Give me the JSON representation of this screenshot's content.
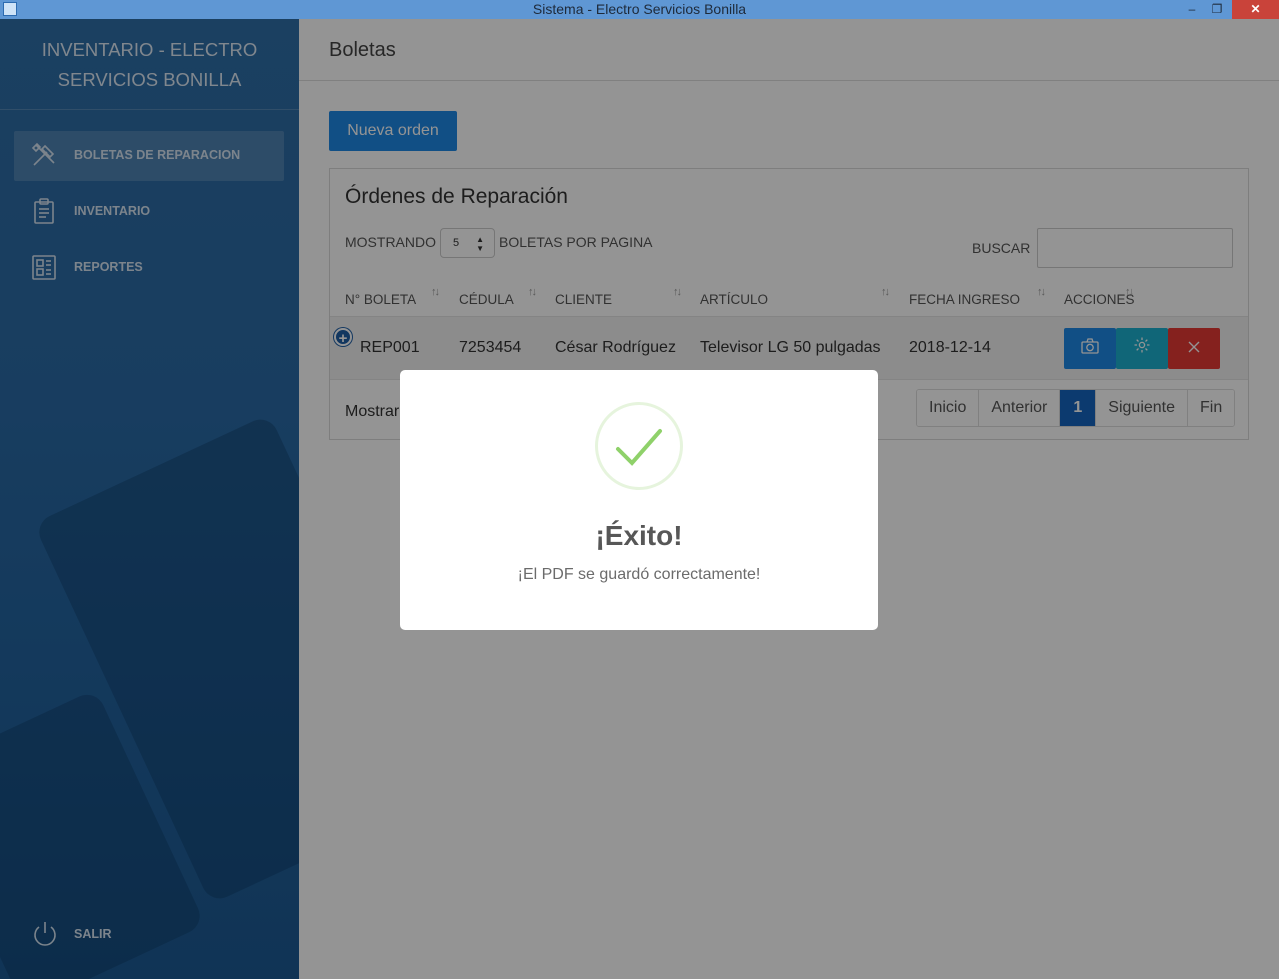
{
  "window": {
    "title": "Sistema - Electro Servicios Bonilla",
    "minimize": "–",
    "maximize": "❐",
    "close": "✕"
  },
  "sidebar": {
    "brand_line1": "INVENTARIO - ELECTRO",
    "brand_line2": "SERVICIOS BONILLA",
    "items": [
      {
        "label": "BOLETAS DE REPARACION",
        "icon": "tools-icon",
        "active": true
      },
      {
        "label": "INVENTARIO",
        "icon": "clipboard-icon",
        "active": false
      },
      {
        "label": "REPORTES",
        "icon": "report-icon",
        "active": false
      }
    ],
    "logout": {
      "label": "SALIR",
      "icon": "power-icon"
    }
  },
  "header": {
    "title": "Boletas"
  },
  "toolbar": {
    "new_order_label": "Nueva orden"
  },
  "orders": {
    "title": "Órdenes de Reparación",
    "show_label": "MOSTRANDO",
    "page_size": "5",
    "per_page_label": "BOLETAS POR PAGINA",
    "search_label": "BUSCAR",
    "search_value": "",
    "columns": [
      "N° BOLETA",
      "CÉDULA",
      "CLIENTE",
      "ARTÍCULO",
      "FECHA INGRESO",
      "ACCIONES"
    ],
    "rows": [
      {
        "boleta": "REP001",
        "cedula": "7253454",
        "cliente": "César Rodríguez",
        "articulo": "Televisor LG 50 pulgadas",
        "fecha": "2018-12-14"
      }
    ],
    "showing_text": "Mostrar",
    "pagination": [
      "Inicio",
      "Anterior",
      "1",
      "Siguiente",
      "Fin"
    ],
    "current_page": "1"
  },
  "colors": {
    "primary": "#1e88e5",
    "info": "#1cb0cf",
    "danger": "#e53935",
    "success": "#8fd16a",
    "sidebar": "#2a6aa5"
  },
  "modal": {
    "icon": "success-check-icon",
    "title": "¡Éxito!",
    "message": "¡El PDF se guardó correctamente!"
  }
}
